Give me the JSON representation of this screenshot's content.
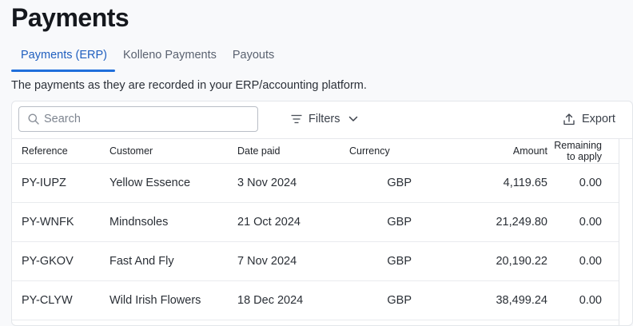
{
  "page": {
    "title": "Payments",
    "subtitle": "The payments as they are recorded in your ERP/accounting platform."
  },
  "tabs": [
    {
      "label": "Payments (ERP)",
      "active": true
    },
    {
      "label": "Kolleno Payments",
      "active": false
    },
    {
      "label": "Payouts",
      "active": false
    }
  ],
  "toolbar": {
    "search_placeholder": "Search",
    "search_value": "",
    "filters_label": "Filters",
    "export_label": "Export"
  },
  "icons": {
    "search": "search-icon",
    "filters": "filter-lines-icon",
    "chevron": "chevron-down-icon",
    "export": "upload-icon"
  },
  "colors": {
    "accent": "#1f6fdb",
    "active_tab_text": "#1f5fbf",
    "page_bg": "#f8f9fb"
  },
  "table": {
    "columns": [
      "Reference",
      "Customer",
      "Date paid",
      "Currency",
      "Amount",
      "Remaining to apply"
    ],
    "rows": [
      [
        "PY-IUPZ",
        "Yellow Essence",
        "3 Nov 2024",
        "GBP",
        "4,119.65",
        "0.00"
      ],
      [
        "PY-WNFK",
        "Mindnsoles",
        "21 Oct 2024",
        "GBP",
        "21,249.80",
        "0.00"
      ],
      [
        "PY-GKOV",
        "Fast And Fly",
        "7 Nov 2024",
        "GBP",
        "20,190.22",
        "0.00"
      ],
      [
        "PY-CLYW",
        "Wild Irish Flowers",
        "18 Dec 2024",
        "GBP",
        "38,499.24",
        "0.00"
      ]
    ]
  }
}
